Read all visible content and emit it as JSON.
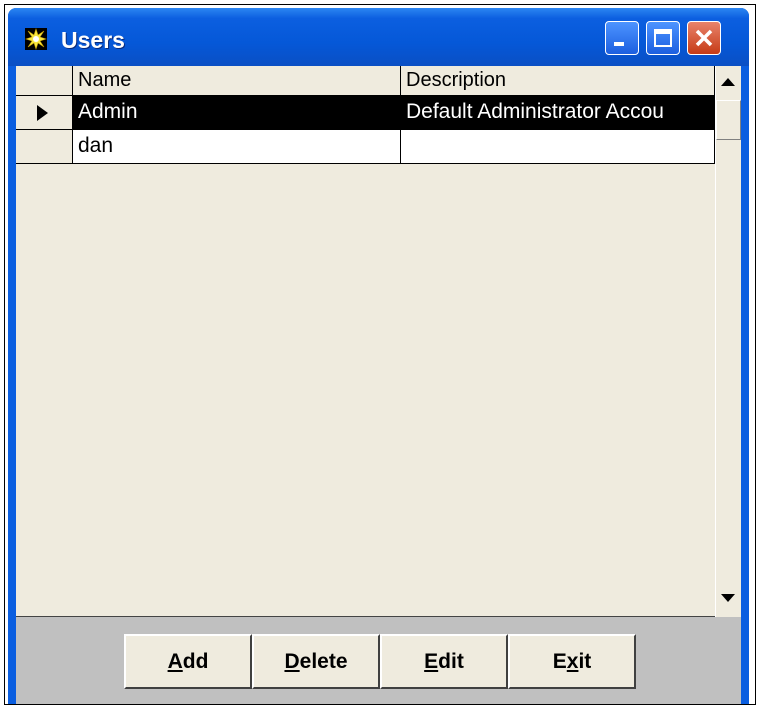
{
  "window": {
    "title": "Users"
  },
  "grid": {
    "columns": [
      "Name",
      "Description"
    ],
    "rows": [
      {
        "name": "Admin",
        "description": "Default Administrator Accou",
        "selected": true
      },
      {
        "name": "dan",
        "description": "",
        "selected": false
      }
    ]
  },
  "buttons": {
    "add": {
      "accel": "A",
      "rest": "dd"
    },
    "delete": {
      "accel": "D",
      "rest": "elete"
    },
    "edit": {
      "accel": "E",
      "rest": "dit"
    },
    "exit": {
      "pre": "E",
      "accel": "x",
      "rest": "it"
    }
  },
  "colors": {
    "titlebar": "#0558d8",
    "grid_bg": "#efebde",
    "selection": "#000000",
    "client_bg": "#c0c0c0"
  },
  "icons": [
    "app-starburst-icon",
    "minimize-icon",
    "maximize-icon",
    "close-icon",
    "row-pointer-icon",
    "scroll-up-icon",
    "scroll-down-icon"
  ]
}
